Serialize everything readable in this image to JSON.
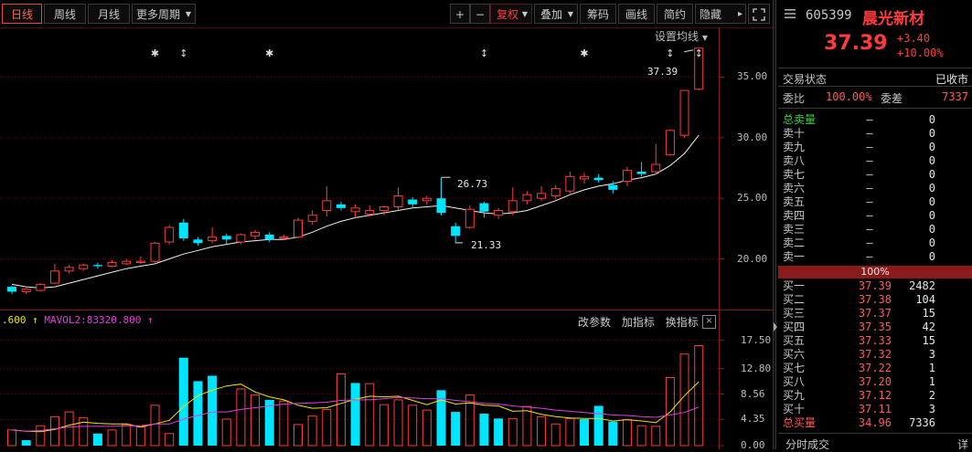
{
  "toolbar": {
    "tabs": [
      "日线",
      "周线",
      "月线",
      "更多周期"
    ],
    "buttons": {
      "plus": "+",
      "minus": "−",
      "fuquan": "复权",
      "overlay": "叠加",
      "chips": "筹码",
      "draw": "画线",
      "brief": "简约",
      "hide": "隐藏"
    },
    "colors": {
      "active": "#ff6a50",
      "accent_red": "#ff3b3b"
    }
  },
  "main_chart": {
    "setting_label": "设置均线",
    "annotations": {
      "high_label": "37.39",
      "mid_high_label": "26.73",
      "low_label": "21.33"
    },
    "star_marks": [
      "✱",
      "↕",
      "✱",
      "↕",
      "✱",
      "↕",
      "↕"
    ]
  },
  "volume_panel": {
    "legend_prefix": ".600",
    "legend_mavol2": "MAVOL2:83320.800",
    "btn_params": "改参数",
    "btn_add": "加指标",
    "btn_switch": "换指标",
    "close_icon": "⊠"
  },
  "quote": {
    "code": "605399",
    "name": "晨光新材",
    "price": "37.39",
    "change": "+3.40",
    "change_pct": "+10.00%",
    "status_label": "交易状态",
    "status_value": "已收市",
    "webi_label": "委比",
    "webi_value": "100.00%",
    "wecha_label": "委差",
    "wecha_value": "7337",
    "sell_total_label": "总卖量",
    "sell_total_price": "—",
    "sell_total_vol": "0",
    "sells": [
      {
        "label": "卖十",
        "price": "—",
        "vol": "0"
      },
      {
        "label": "卖九",
        "price": "—",
        "vol": "0"
      },
      {
        "label": "卖八",
        "price": "—",
        "vol": "0"
      },
      {
        "label": "卖七",
        "price": "—",
        "vol": "0"
      },
      {
        "label": "卖六",
        "price": "—",
        "vol": "0"
      },
      {
        "label": "卖五",
        "price": "—",
        "vol": "0"
      },
      {
        "label": "卖四",
        "price": "—",
        "vol": "0"
      },
      {
        "label": "卖三",
        "price": "—",
        "vol": "0"
      },
      {
        "label": "卖二",
        "price": "—",
        "vol": "0"
      },
      {
        "label": "卖一",
        "price": "—",
        "vol": "0"
      }
    ],
    "ratio_bar": "100%",
    "buys": [
      {
        "label": "买一",
        "price": "37.39",
        "vol": "2482"
      },
      {
        "label": "买二",
        "price": "37.38",
        "vol": "104"
      },
      {
        "label": "买三",
        "price": "37.37",
        "vol": "15"
      },
      {
        "label": "买四",
        "price": "37.35",
        "vol": "42"
      },
      {
        "label": "买五",
        "price": "37.33",
        "vol": "15"
      },
      {
        "label": "买六",
        "price": "37.32",
        "vol": "3"
      },
      {
        "label": "买七",
        "price": "37.22",
        "vol": "1"
      },
      {
        "label": "买八",
        "price": "37.20",
        "vol": "1"
      },
      {
        "label": "买九",
        "price": "37.12",
        "vol": "2"
      },
      {
        "label": "买十",
        "price": "37.11",
        "vol": "3"
      }
    ],
    "buy_total_label": "总买量",
    "buy_total_price": "34.96",
    "buy_total_vol": "7336",
    "footer": "分时成交",
    "footer_detail": "详"
  },
  "chart_data": [
    {
      "type": "candlestick",
      "y_ticks": [
        "35.00",
        "30.00",
        "25.00",
        "20.00"
      ],
      "ylim": [
        16.5,
        38.5
      ],
      "candles": [
        {
          "o": 17.7,
          "c": 17.3,
          "h": 17.8,
          "l": 17.1
        },
        {
          "o": 17.3,
          "c": 17.5,
          "h": 17.6,
          "l": 17.1
        },
        {
          "o": 17.4,
          "c": 17.9,
          "h": 18.0,
          "l": 17.3
        },
        {
          "o": 18.0,
          "c": 19.0,
          "h": 19.6,
          "l": 17.9
        },
        {
          "o": 19.0,
          "c": 19.3,
          "h": 19.5,
          "l": 18.8
        },
        {
          "o": 19.2,
          "c": 19.5,
          "h": 19.6,
          "l": 19.0
        },
        {
          "o": 19.5,
          "c": 19.4,
          "h": 19.7,
          "l": 19.2
        },
        {
          "o": 19.4,
          "c": 19.7,
          "h": 19.9,
          "l": 19.3
        },
        {
          "o": 19.6,
          "c": 19.8,
          "h": 20.0,
          "l": 19.5
        },
        {
          "o": 19.7,
          "c": 19.8,
          "h": 20.2,
          "l": 19.6
        },
        {
          "o": 19.8,
          "c": 21.3,
          "h": 21.4,
          "l": 19.7
        },
        {
          "o": 21.4,
          "c": 22.6,
          "h": 22.8,
          "l": 21.2
        },
        {
          "o": 23.0,
          "c": 21.7,
          "h": 23.3,
          "l": 21.5
        },
        {
          "o": 21.6,
          "c": 21.3,
          "h": 21.8,
          "l": 21.1
        },
        {
          "o": 21.5,
          "c": 21.8,
          "h": 22.6,
          "l": 21.3
        },
        {
          "o": 21.9,
          "c": 21.6,
          "h": 22.1,
          "l": 21.2
        },
        {
          "o": 21.4,
          "c": 22.0,
          "h": 22.1,
          "l": 21.2
        },
        {
          "o": 21.9,
          "c": 22.2,
          "h": 22.4,
          "l": 21.6
        },
        {
          "o": 22.0,
          "c": 21.6,
          "h": 22.2,
          "l": 21.4
        },
        {
          "o": 21.7,
          "c": 21.8,
          "h": 22.0,
          "l": 21.6
        },
        {
          "o": 21.8,
          "c": 23.2,
          "h": 23.4,
          "l": 21.7
        },
        {
          "o": 23.1,
          "c": 23.6,
          "h": 24.0,
          "l": 22.8
        },
        {
          "o": 24.0,
          "c": 24.8,
          "h": 26.0,
          "l": 23.5
        },
        {
          "o": 24.5,
          "c": 24.2,
          "h": 24.7,
          "l": 24.0
        },
        {
          "o": 23.9,
          "c": 24.2,
          "h": 24.5,
          "l": 23.4
        },
        {
          "o": 23.7,
          "c": 24.0,
          "h": 24.4,
          "l": 23.5
        },
        {
          "o": 24.0,
          "c": 24.3,
          "h": 24.4,
          "l": 23.6
        },
        {
          "o": 24.3,
          "c": 25.2,
          "h": 25.9,
          "l": 24.0
        },
        {
          "o": 24.9,
          "c": 24.5,
          "h": 25.1,
          "l": 24.2
        },
        {
          "o": 24.8,
          "c": 25.0,
          "h": 25.2,
          "l": 24.5
        },
        {
          "o": 25.0,
          "c": 23.8,
          "h": 26.7,
          "l": 23.6
        },
        {
          "o": 22.7,
          "c": 21.9,
          "h": 23.0,
          "l": 21.3
        },
        {
          "o": 22.6,
          "c": 24.1,
          "h": 24.4,
          "l": 22.5
        },
        {
          "o": 24.6,
          "c": 23.9,
          "h": 24.7,
          "l": 23.4
        },
        {
          "o": 23.6,
          "c": 24.0,
          "h": 24.2,
          "l": 23.3
        },
        {
          "o": 23.9,
          "c": 24.8,
          "h": 25.9,
          "l": 23.6
        },
        {
          "o": 24.8,
          "c": 25.3,
          "h": 25.6,
          "l": 24.5
        },
        {
          "o": 25.0,
          "c": 25.4,
          "h": 26.0,
          "l": 24.8
        },
        {
          "o": 25.2,
          "c": 25.8,
          "h": 26.1,
          "l": 24.9
        },
        {
          "o": 25.6,
          "c": 26.8,
          "h": 27.2,
          "l": 25.4
        },
        {
          "o": 26.6,
          "c": 26.8,
          "h": 27.1,
          "l": 26.2
        },
        {
          "o": 26.7,
          "c": 26.5,
          "h": 27.0,
          "l": 26.3
        },
        {
          "o": 26.1,
          "c": 25.7,
          "h": 26.4,
          "l": 25.4
        },
        {
          "o": 26.4,
          "c": 27.3,
          "h": 27.6,
          "l": 26.0
        },
        {
          "o": 27.2,
          "c": 27.0,
          "h": 28.0,
          "l": 26.8
        },
        {
          "o": 27.2,
          "c": 27.8,
          "h": 29.5,
          "l": 27.0
        },
        {
          "o": 28.6,
          "c": 30.6,
          "h": 30.7,
          "l": 28.5
        },
        {
          "o": 30.2,
          "c": 33.9,
          "h": 33.9,
          "l": 30.0
        },
        {
          "o": 34.0,
          "c": 37.39,
          "h": 37.39,
          "l": 33.9
        }
      ],
      "ma_line": [
        17.9,
        17.7,
        17.6,
        17.7,
        18.0,
        18.3,
        18.6,
        18.9,
        19.2,
        19.4,
        19.6,
        20.0,
        20.4,
        20.7,
        21.0,
        21.2,
        21.4,
        21.5,
        21.6,
        21.6,
        21.8,
        22.2,
        22.7,
        23.1,
        23.4,
        23.6,
        23.8,
        24.0,
        24.2,
        24.3,
        24.4,
        24.2,
        24.0,
        23.8,
        23.7,
        23.8,
        24.0,
        24.4,
        24.8,
        25.3,
        25.7,
        26.0,
        26.2,
        26.5,
        26.7,
        27.0,
        27.7,
        28.7,
        30.2
      ]
    },
    {
      "type": "bar",
      "title": "VOL",
      "y_ticks": [
        "17.50",
        "12.80",
        "8.56",
        "4.35",
        "0.00"
      ],
      "ylim": [
        0,
        18.5
      ],
      "values": [
        2.6,
        0.9,
        3.3,
        4.8,
        5.6,
        4.6,
        2.0,
        2.6,
        3.5,
        3.1,
        6.7,
        2.0,
        14.6,
        10.7,
        11.6,
        4.4,
        9.4,
        8.4,
        7.6,
        7.4,
        3.5,
        4.9,
        6.0,
        11.9,
        10.4,
        10.3,
        6.8,
        7.6,
        6.7,
        5.9,
        9.2,
        5.6,
        8.4,
        5.3,
        4.5,
        4.5,
        6.5,
        4.8,
        3.6,
        4.5,
        4.4,
        6.6,
        4.0,
        4.3,
        3.3,
        3.2,
        11.3,
        15.2,
        16.6
      ],
      "up": [
        1,
        0,
        1,
        1,
        1,
        1,
        0,
        1,
        1,
        1,
        1,
        1,
        0,
        0,
        0,
        1,
        1,
        1,
        0,
        1,
        1,
        1,
        1,
        1,
        0,
        1,
        1,
        1,
        1,
        1,
        0,
        0,
        1,
        0,
        0,
        1,
        1,
        1,
        1,
        1,
        0,
        0,
        0,
        1,
        1,
        1,
        1,
        1,
        1
      ],
      "ma1": [
        2.6,
        2.4,
        2.3,
        2.7,
        3.4,
        3.9,
        3.7,
        3.6,
        3.6,
        3.1,
        3.6,
        4.2,
        6.5,
        8.3,
        9.2,
        9.9,
        10.2,
        8.9,
        8.1,
        7.6,
        6.7,
        6.2,
        6.3,
        7.0,
        7.7,
        8.2,
        8.1,
        8.2,
        7.5,
        6.8,
        7.6,
        6.9,
        7.1,
        6.7,
        6.6,
        5.7,
        5.8,
        5.2,
        4.8,
        4.6,
        4.5,
        4.5,
        4.1,
        4.3,
        4.1,
        3.8,
        5.6,
        8.3,
        10.6
      ],
      "ma2": [
        2.6,
        2.4,
        2.5,
        2.8,
        3.1,
        3.2,
        3.2,
        3.2,
        3.3,
        3.3,
        3.6,
        3.6,
        4.4,
        5.0,
        5.6,
        5.6,
        6.0,
        6.3,
        6.6,
        6.9,
        7.0,
        7.1,
        7.2,
        7.5,
        7.6,
        7.6,
        7.8,
        8.0,
        7.9,
        7.8,
        7.8,
        7.5,
        7.3,
        7.0,
        6.9,
        6.6,
        6.4,
        6.2,
        5.9,
        5.7,
        5.5,
        5.3,
        5.1,
        5.0,
        4.8,
        4.7,
        5.1,
        5.5,
        6.4
      ]
    }
  ]
}
